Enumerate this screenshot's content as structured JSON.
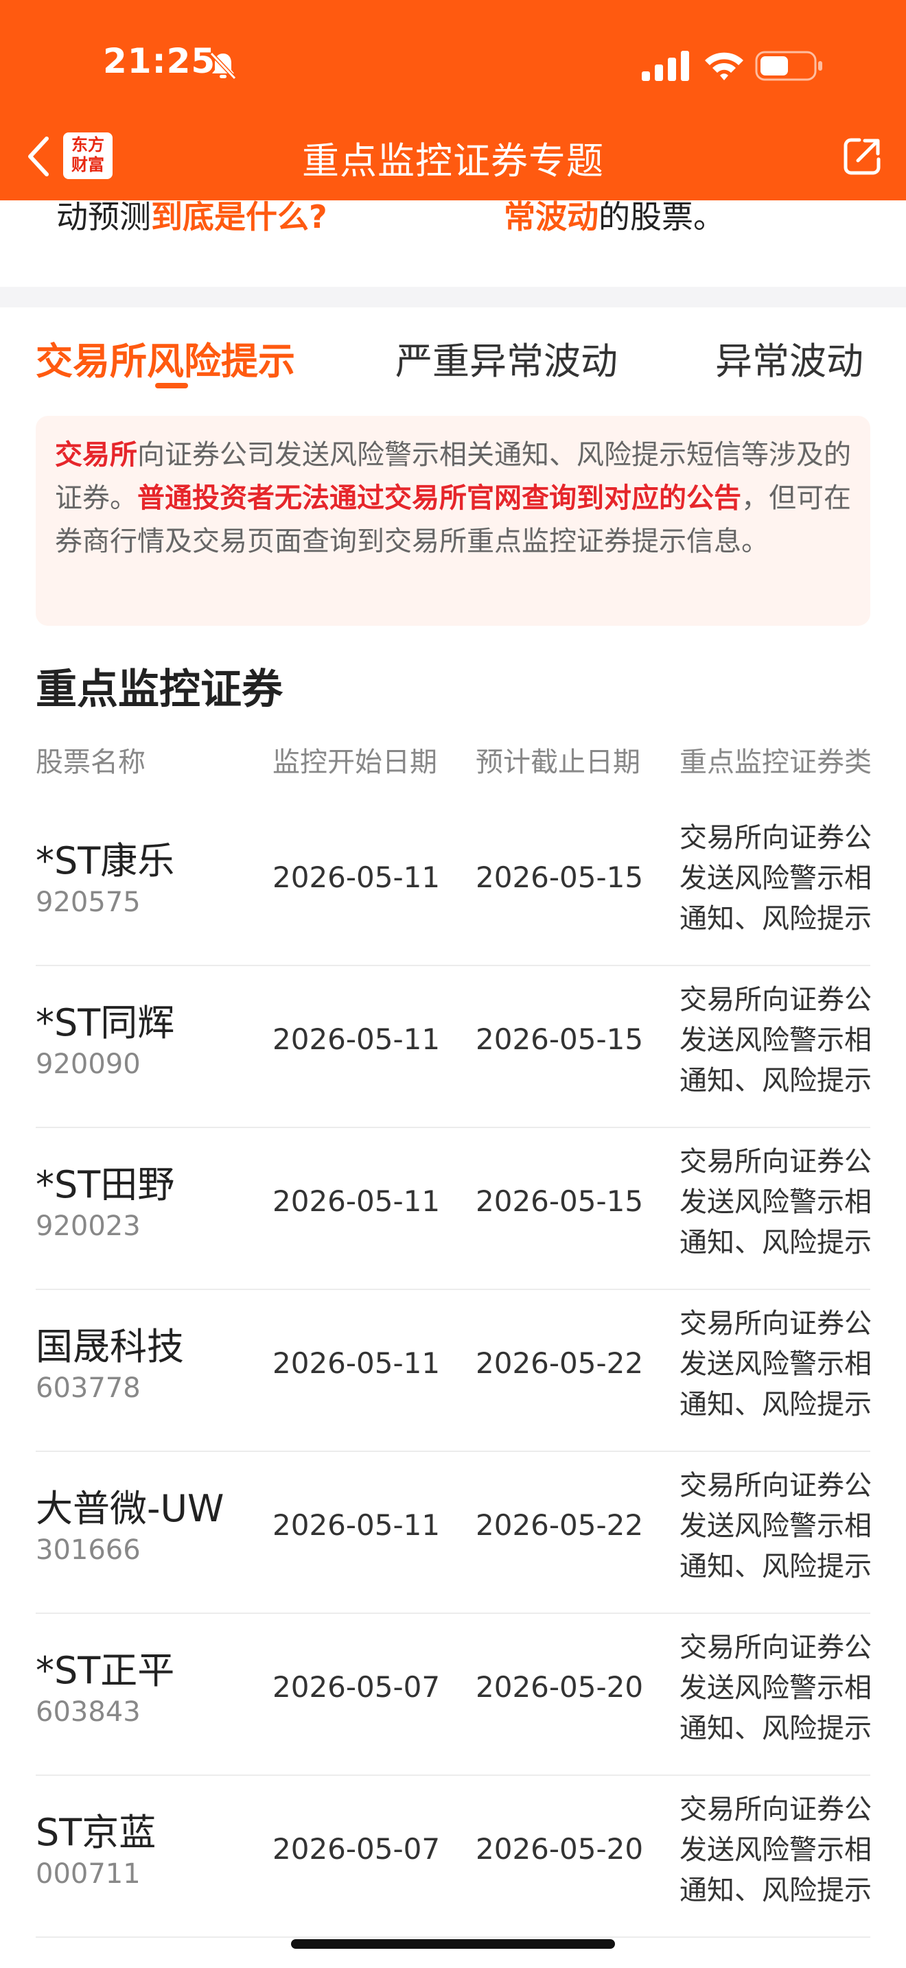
{
  "status": {
    "time": "21:25"
  },
  "header": {
    "title": "重点监控证券专题",
    "logo": [
      "东方",
      "财富"
    ]
  },
  "intro": {
    "a_plain": "动预测",
    "a_accent": "到底是什么?",
    "b_accent": "常波动",
    "b_plain": "的股票。"
  },
  "tabs": [
    {
      "label": "交易所风险提示",
      "active": true
    },
    {
      "label": "严重异常波动"
    },
    {
      "label": "异常波动"
    }
  ],
  "notice": {
    "p1": "交易所",
    "p2": "向证券公司发送风险警示相关通知、风险提示短信等涉及的证券。",
    "p3": "普通投资者无法通过交易所官网查询到对应的公告",
    "p4": "，但可在券商行情及交易页面查询到交易所重点监控证券提示信息。"
  },
  "section_title": "重点监控证券",
  "table": {
    "headers": [
      "股票名称",
      "监控开始日期",
      "预计截止日期",
      "重点监控证券类"
    ],
    "type_text": "交易所向证券公司发送风险警示相关通知、风险提示短信等涉及的证券",
    "rows": [
      {
        "name": "*ST康乐",
        "code": "920575",
        "start": "2026-05-11",
        "end": "2026-05-15"
      },
      {
        "name": "*ST同辉",
        "code": "920090",
        "start": "2026-05-11",
        "end": "2026-05-15"
      },
      {
        "name": "*ST田野",
        "code": "920023",
        "start": "2026-05-11",
        "end": "2026-05-15"
      },
      {
        "name": "国晟科技",
        "code": "603778",
        "start": "2026-05-11",
        "end": "2026-05-22"
      },
      {
        "name": "大普微-UW",
        "code": "301666",
        "start": "2026-05-11",
        "end": "2026-05-22"
      },
      {
        "name": "*ST正平",
        "code": "603843",
        "start": "2026-05-07",
        "end": "2026-05-20"
      },
      {
        "name": "ST京蓝",
        "code": "000711",
        "start": "2026-05-07",
        "end": "2026-05-20"
      }
    ]
  },
  "colors": {
    "brand": "#ff5a10",
    "alert": "#e6262b",
    "notice_bg": "#fff4f0"
  },
  "icons": [
    "bell-muted-icon",
    "signal-icon",
    "wifi-icon",
    "battery-icon",
    "back-arrow-icon",
    "share-icon"
  ]
}
